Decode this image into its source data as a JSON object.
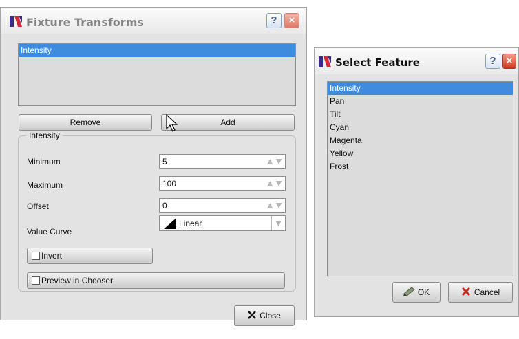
{
  "fixture_transforms": {
    "title": "Fixture Transforms",
    "help_label": "?",
    "close_x": "×",
    "transforms_list": [
      "Intensity"
    ],
    "remove_label": "Remove",
    "add_label": "Add",
    "group_title": "Intensity",
    "fields": {
      "minimum": {
        "label": "Minimum",
        "value": "5"
      },
      "maximum": {
        "label": "Maximum",
        "value": "100"
      },
      "offset": {
        "label": "Offset",
        "value": "0"
      },
      "value_curve": {
        "label": "Value Curve",
        "value": "Linear"
      }
    },
    "invert_label": "Invert",
    "invert_checked": false,
    "preview_label": "Preview in Chooser",
    "preview_checked": false,
    "close_label": "Close",
    "spin_arrows": "▲▼",
    "dropdown_arrow": "▼"
  },
  "select_feature": {
    "title": "Select Feature",
    "help_label": "?",
    "close_x": "×",
    "features": [
      "Intensity",
      "Pan",
      "Tilt",
      "Cyan",
      "Magenta",
      "Yellow",
      "Frost"
    ],
    "selected_index": 0,
    "ok_label": "OK",
    "cancel_label": "Cancel"
  },
  "icons": {
    "app": "app-logo-icon",
    "close": "close-x-icon",
    "ok": "pen-check-icon",
    "cancel": "red-x-icon",
    "curve": "linear-ramp-icon",
    "cursor": "mouse-pointer-icon"
  },
  "colors": {
    "selection": "#3f8bdd",
    "window_bg": "#e3e3e3",
    "list_bg": "#dcdcdc",
    "title_close": "#cf3a1e",
    "logo_purple": "#3a2a8c",
    "logo_red": "#d42a3c"
  }
}
